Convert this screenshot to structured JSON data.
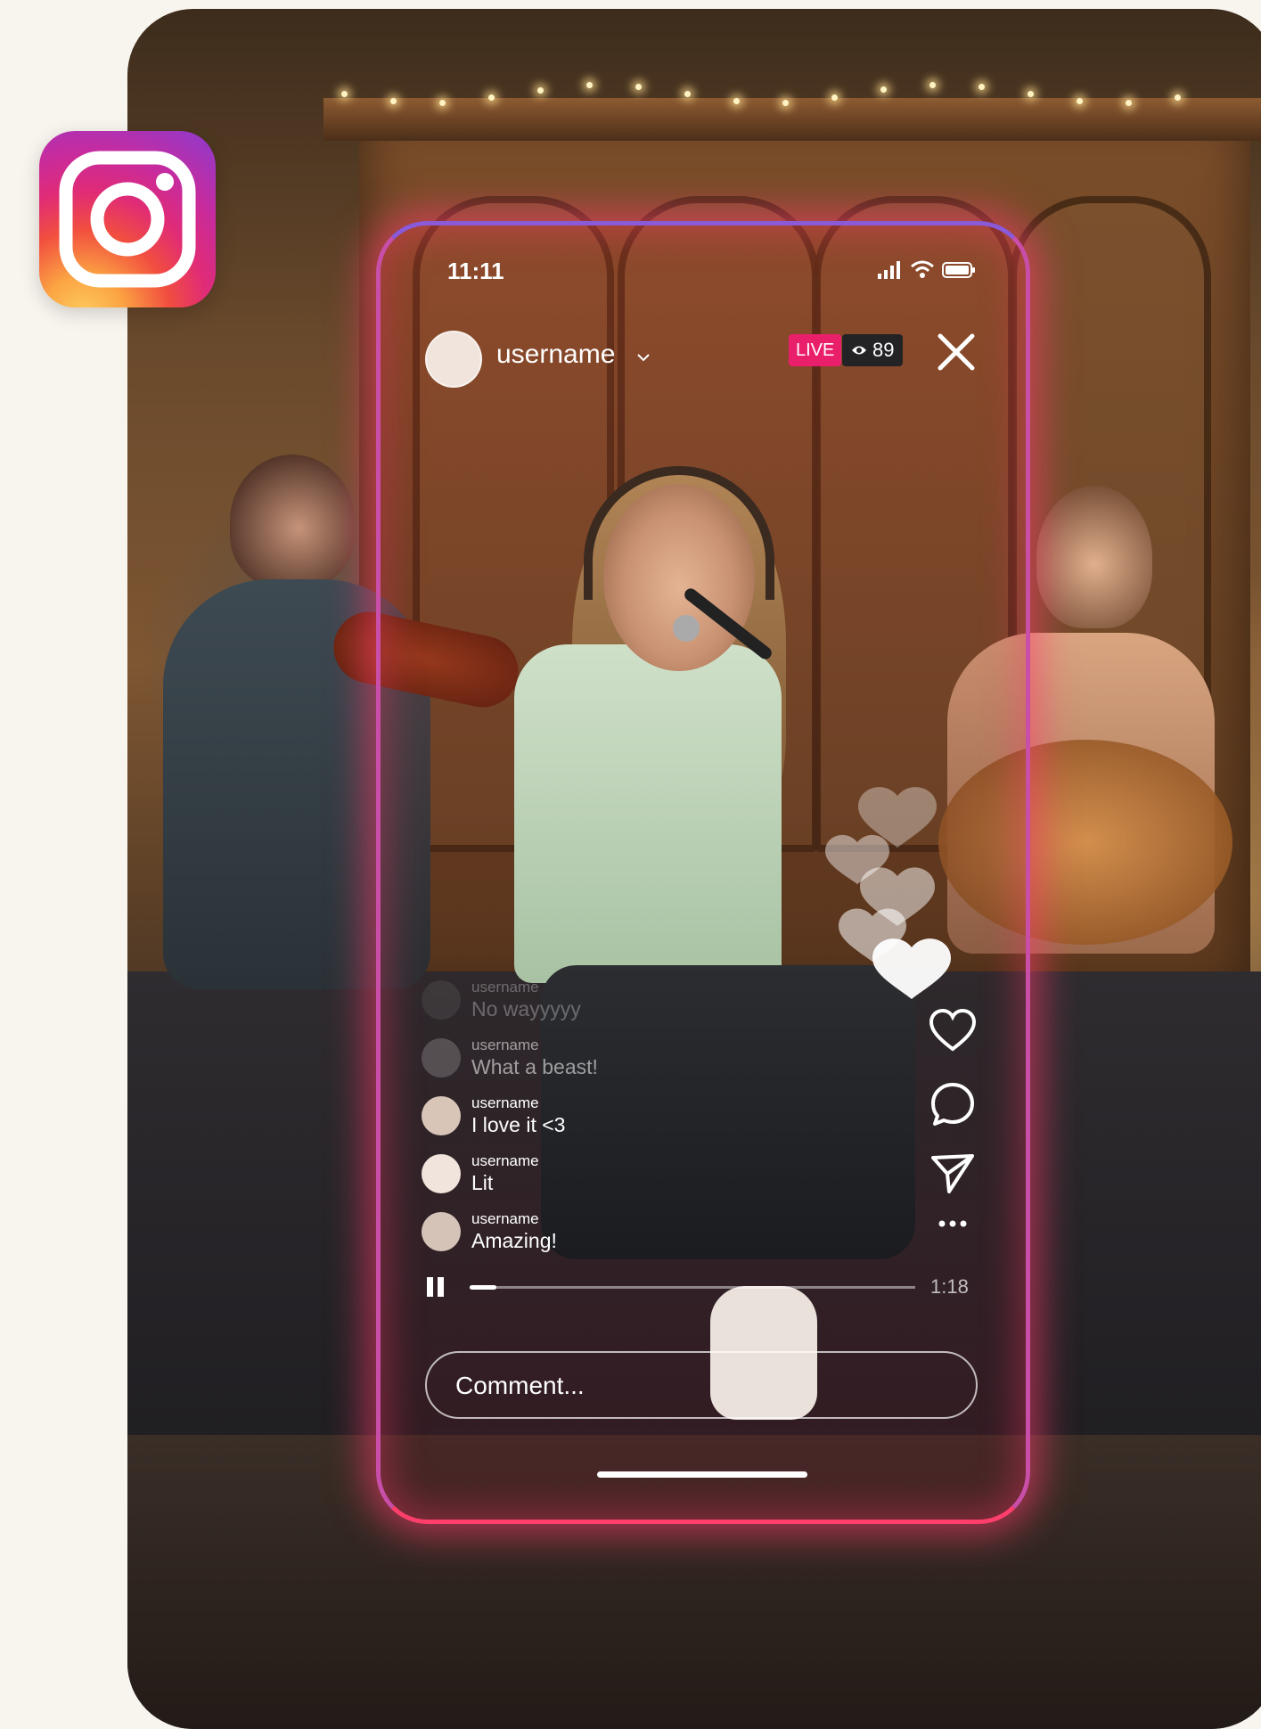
{
  "status_bar": {
    "time": "11:11"
  },
  "header": {
    "username": "username",
    "live_label": "LIVE",
    "viewer_count": "89"
  },
  "comments": [
    {
      "user": "username",
      "text": "No wayyyyy",
      "faded": true
    },
    {
      "user": "username",
      "text": "What a beast!",
      "faded": true
    },
    {
      "user": "username",
      "text": "I love it <3",
      "faded": false
    },
    {
      "user": "username",
      "text": "Lit",
      "faded": false
    },
    {
      "user": "username",
      "text": "Amazing!",
      "faded": false
    }
  ],
  "playback": {
    "progress_fraction": 0.06,
    "time_left": "1:18"
  },
  "comment_input": {
    "placeholder": "Comment..."
  },
  "icons": {
    "logo": "instagram-logo-icon",
    "close": "close-icon",
    "like": "heart-icon",
    "comment": "comment-icon",
    "share": "send-icon",
    "more": "more-icon",
    "pause": "pause-icon",
    "eye": "eye-icon"
  },
  "colors": {
    "live_badge": "#ea1f6b",
    "frame_glow": "#ff3f6b",
    "frame_top": "#8a5ad8"
  }
}
